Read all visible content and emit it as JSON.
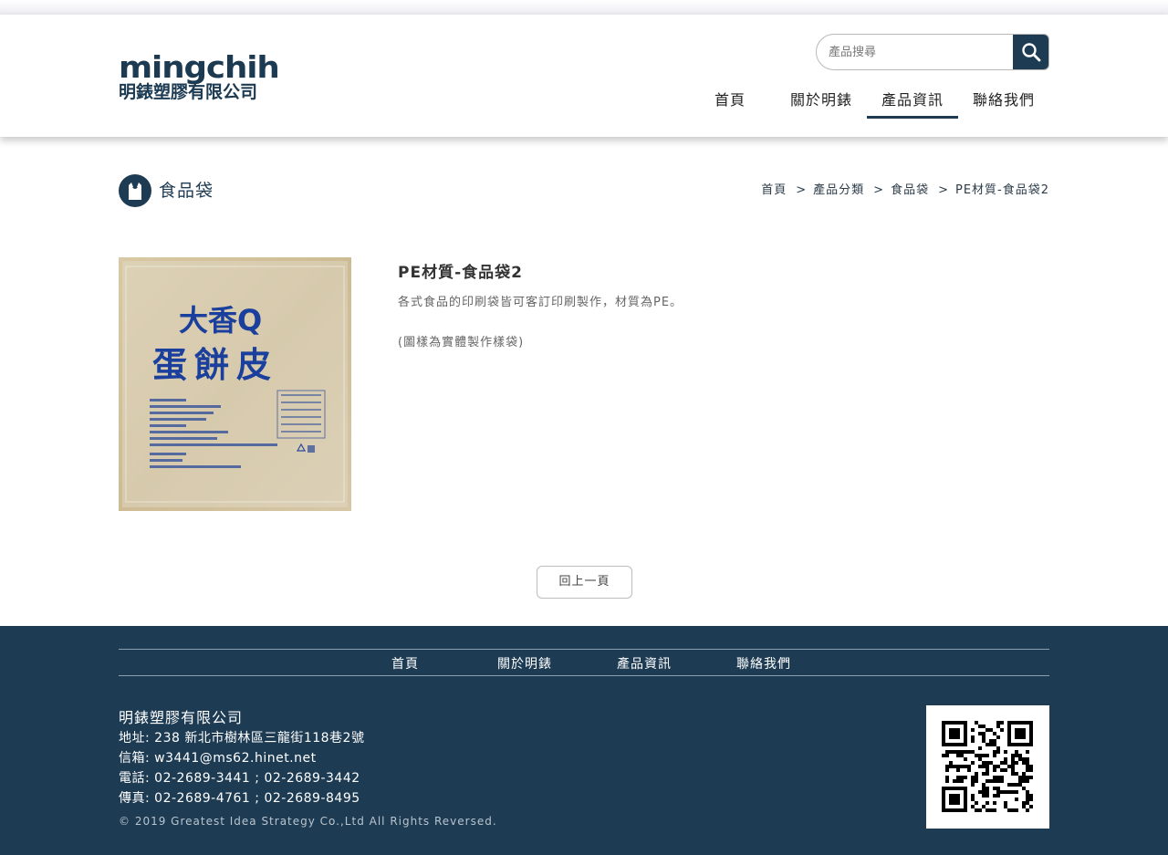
{
  "brand": {
    "name_latin": "mingchih",
    "name_cn": "明錶塑膠有限公司"
  },
  "search": {
    "placeholder": "產品搜尋"
  },
  "nav": [
    {
      "label": "首頁",
      "active": false
    },
    {
      "label": "關於明錶",
      "active": false
    },
    {
      "label": "產品資訊",
      "active": true
    },
    {
      "label": "聯絡我們",
      "active": false
    }
  ],
  "page": {
    "title": "食品袋",
    "icon": "shopping-bag-icon"
  },
  "breadcrumb": [
    "首頁",
    "產品分類",
    "食品袋",
    "PE材質-食品袋2"
  ],
  "product": {
    "title": "PE材質-食品袋2",
    "description": "各式食品的印刷袋皆可客訂印刷製作，材質為PE。",
    "note": "(圖樣為實體製作樣袋)",
    "image_text": {
      "line1": "大香Q",
      "line2": "蛋餅皮"
    }
  },
  "back_button": "回上一頁",
  "footer": {
    "nav": [
      "首頁",
      "關於明錶",
      "產品資訊",
      "聯絡我們"
    ],
    "company": "明錶塑膠有限公司",
    "address": "地址: 238 新北市樹林區三龍街118巷2號",
    "email": "信箱: w3441@ms62.hinet.net",
    "phone": "電話: 02-2689-3441 ; 02-2689-3442",
    "fax": "傳真: 02-2689-4761 ; 02-2689-8495",
    "copyright": "© 2019 Greatest Idea Strategy Co.,Ltd All Rights Reversed."
  },
  "colors": {
    "brand_navy": "#1d3b53",
    "footer_bg": "#1d3b53",
    "bag_print_blue": "#1a3f9c"
  }
}
